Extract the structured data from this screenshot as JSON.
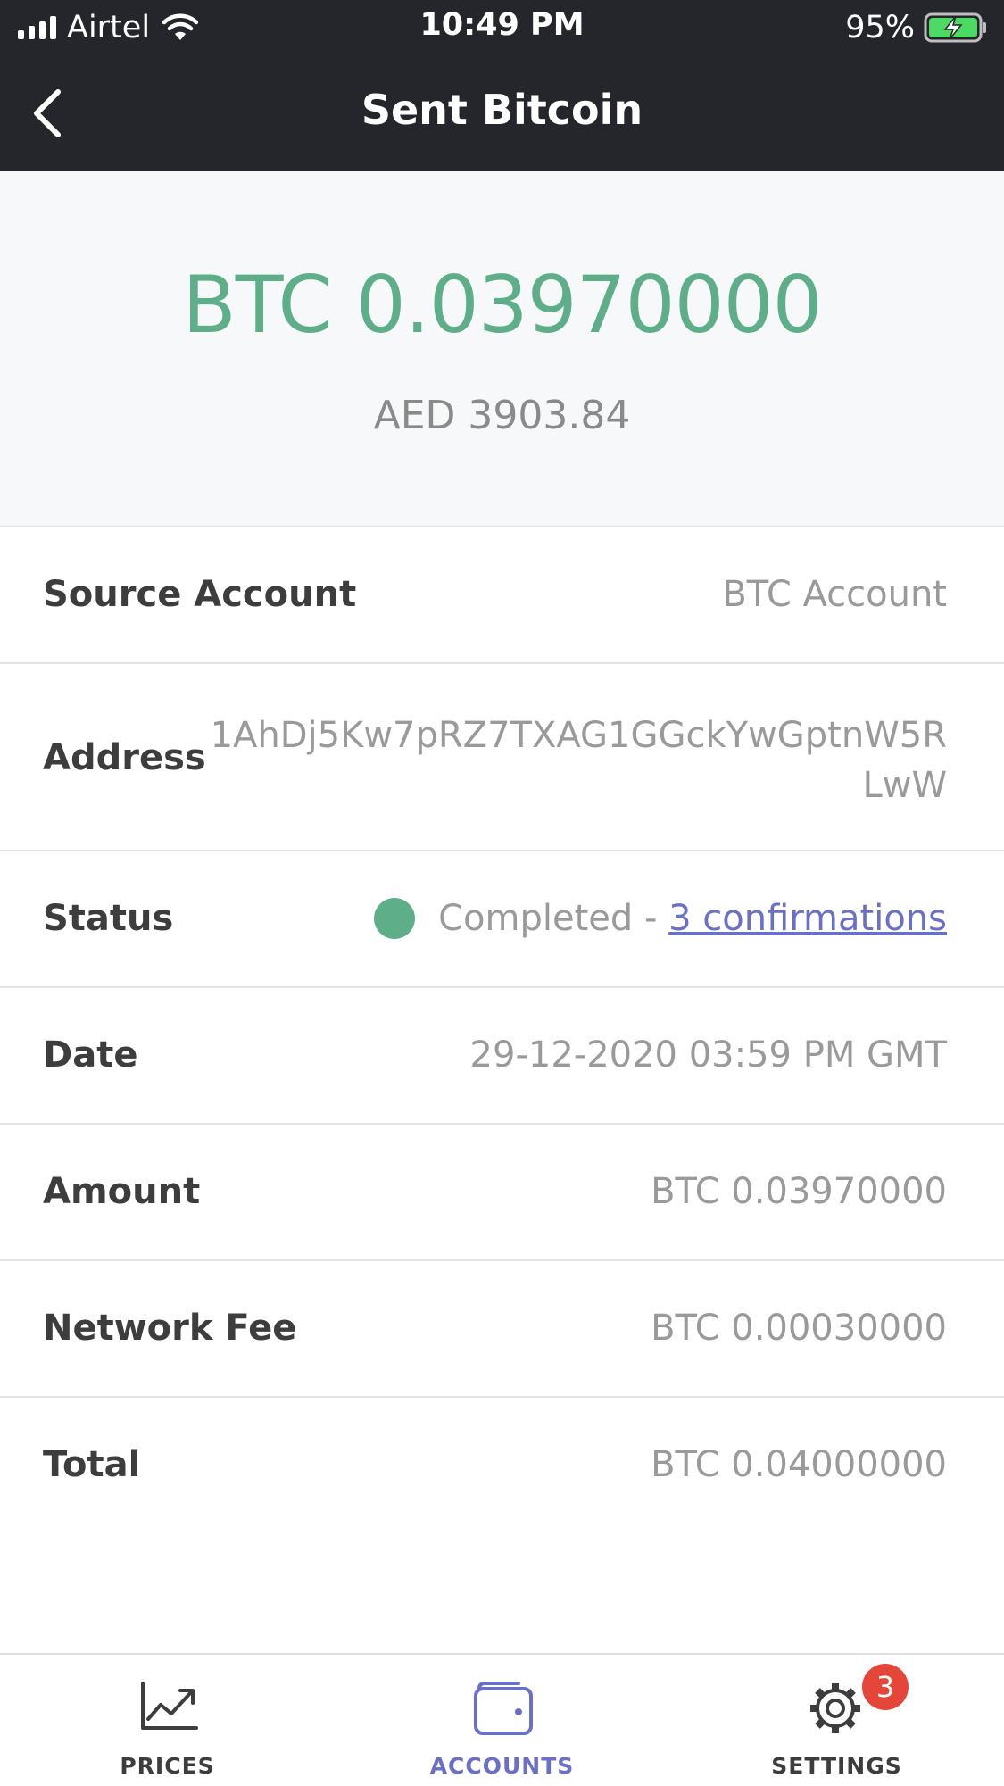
{
  "status_bar": {
    "carrier": "Airtel",
    "time": "10:49 PM",
    "battery_percent": "95%",
    "icons": [
      "signal-icon",
      "wifi-icon",
      "battery-charging-icon"
    ]
  },
  "nav": {
    "title": "Sent Bitcoin",
    "back_icon": "chevron-left-icon"
  },
  "hero": {
    "btc_amount": "BTC 0.03970000",
    "fiat_amount": "AED 3903.84"
  },
  "details": {
    "source_account": {
      "label": "Source Account",
      "value": "BTC Account"
    },
    "address": {
      "label": "Address",
      "value": "1AhDj5Kw7pRZ7TXAG1GGckYwGptnW5RLwW"
    },
    "status": {
      "label": "Status",
      "value": "Completed - ",
      "link": "3 confirmations"
    },
    "date": {
      "label": "Date",
      "value": "29-12-2020 03:59 PM GMT"
    },
    "amount": {
      "label": "Amount",
      "value": "BTC 0.03970000"
    },
    "network_fee": {
      "label": "Network Fee",
      "value": "BTC 0.00030000"
    },
    "total": {
      "label": "Total",
      "value": "BTC 0.04000000"
    }
  },
  "tabbar": {
    "tabs": [
      {
        "label": "PRICES",
        "icon": "chart-icon",
        "active": false
      },
      {
        "label": "ACCOUNTS",
        "icon": "wallet-icon",
        "active": true
      },
      {
        "label": "SETTINGS",
        "icon": "gear-icon",
        "active": false,
        "badge": "3"
      }
    ]
  },
  "colors": {
    "header_bg": "#24262b",
    "accent_green": "#5fae8a",
    "link_purple": "#6a70c8",
    "badge_red": "#e6463a"
  }
}
